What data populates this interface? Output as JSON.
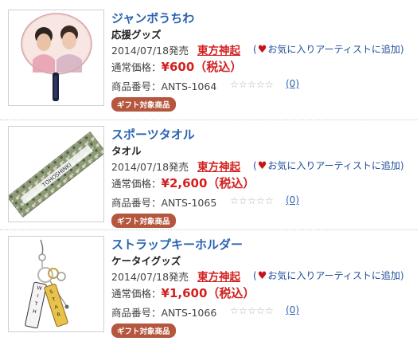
{
  "products": [
    {
      "title": "ジャンボうちわ",
      "category": "応援グッズ",
      "date": "2014/07/18発売",
      "artist": "東方神起",
      "fav_open": "(",
      "fav_text": "お気に入りアーティストに追加",
      "fav_close": ")",
      "price_label": "通常価格：",
      "price": "¥600（税込）",
      "code": "商品番号：ANTS-1064",
      "reviews": "(0)",
      "badge": "ギフト対象商品",
      "image": "fan-photo"
    },
    {
      "title": "スポーツタオル",
      "category": "タオル",
      "date": "2014/07/18発売",
      "artist": "東方神起",
      "fav_open": "(",
      "fav_text": "お気に入りアーティストに追加",
      "fav_close": ")",
      "price_label": "通常価格：",
      "price": "¥2,600（税込）",
      "code": "商品番号：ANTS-1065",
      "reviews": "(0)",
      "badge": "ギフト対象商品",
      "image": "towel-photo"
    },
    {
      "title": "ストラップキーホルダー",
      "category": "ケータイグッズ",
      "date": "2014/07/18発売",
      "artist": "東方神起",
      "fav_open": "(",
      "fav_text": "お気に入りアーティストに追加",
      "fav_close": ")",
      "price_label": "通常価格：",
      "price": "¥1,600（税込）",
      "code": "商品番号：ANTS-1066",
      "reviews": "(0)",
      "badge": "ギフト対象商品",
      "image": "strap-photo"
    }
  ],
  "colors": {
    "title": "#2a63b0",
    "price": "#d32020",
    "badge": "#b5563e",
    "heart": "#c4141a"
  },
  "rating": {
    "stars_max": 5,
    "stars_value": 0
  }
}
